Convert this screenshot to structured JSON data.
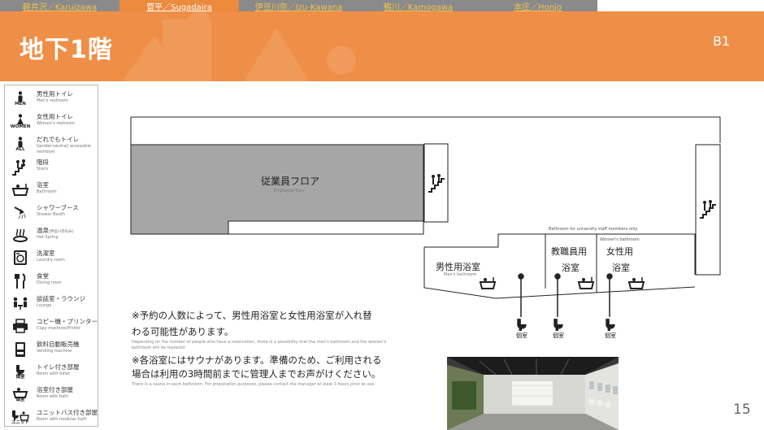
{
  "nav": {
    "tabs": [
      {
        "label": "軽井沢／Karuizawa",
        "active": false
      },
      {
        "label": "菅平／Sugadaira",
        "active": true
      },
      {
        "label": "伊豆川奈／Izu-Kawana",
        "active": false
      },
      {
        "label": "鴨川／Kamogawa",
        "active": false
      },
      {
        "label": "本庄／Honjo",
        "active": false
      }
    ]
  },
  "header": {
    "title": "地下1階",
    "floor_code": "B1",
    "color": "#ee8e47"
  },
  "legend": {
    "items": [
      {
        "ja": "男性用トイレ",
        "en": "Men's restroom",
        "icon": "men-restroom-icon",
        "caption": "MEN"
      },
      {
        "ja": "女性用トイレ",
        "en": "Women's restroom",
        "icon": "women-restroom-icon",
        "caption": "WOMEN"
      },
      {
        "ja": "だれでもトイレ",
        "en": "Gender-neutral/ accessible restroom",
        "icon": "all-restroom-icon",
        "caption": "ALL"
      },
      {
        "ja": "階段",
        "en": "Stairs",
        "icon": "stairs-icon",
        "caption": ""
      },
      {
        "ja": "浴室",
        "en": "Bathroom",
        "icon": "bathtub-icon",
        "caption": ""
      },
      {
        "ja": "シャワーブース",
        "en": "Shower Booth",
        "icon": "shower-icon",
        "caption": ""
      },
      {
        "ja": "温泉",
        "en": "Hot Spring",
        "ja_sub": "(伊豆川奈のみ)",
        "icon": "hot-spring-icon",
        "caption": ""
      },
      {
        "ja": "洗濯室",
        "en": "Laundry room",
        "icon": "laundry-icon",
        "caption": ""
      },
      {
        "ja": "食堂",
        "en": "Dining room",
        "icon": "dining-icon",
        "caption": ""
      },
      {
        "ja": "談話室・ラウンジ",
        "en": "Lounge",
        "icon": "lounge-icon",
        "caption": ""
      },
      {
        "ja": "コピー機・プリンター",
        "en": "Copy machine/Printer",
        "icon": "printer-icon",
        "caption": ""
      },
      {
        "ja": "飲料自動販売機",
        "en": "Vending machine",
        "icon": "vending-machine-icon",
        "caption": ""
      },
      {
        "ja": "トイレ付き部屋",
        "en": "Room with toilet",
        "icon": "room-toilet-icon",
        "caption": "個室"
      },
      {
        "ja": "浴室付き部屋",
        "en": "Room with bath",
        "icon": "room-bath-icon",
        "caption": "個室"
      },
      {
        "ja": "ユニットバス付き部屋",
        "en": "Room with modular bath",
        "icon": "room-unitbath-icon",
        "caption": "ユニット"
      }
    ]
  },
  "plan": {
    "employee_floor": "従業員フロア",
    "employee_floor_en": "Employee floor",
    "staff_note": "Bathroom for university staff members only",
    "mens_bath": "男性用浴室",
    "mens_bath_en": "Men's bathroom",
    "staff_bath_1": "教職員用",
    "staff_bath_2": "浴室",
    "womens_bath_en": "Women's bathroom",
    "womens_bath_1": "女性用",
    "womens_bath_2": "浴室",
    "private_label": "個室"
  },
  "notes": {
    "note1_line1": "※予約の人数によって、男性用浴室と女性用浴室が入れ替",
    "note1_line2": "わる可能性があります。",
    "note1_en_line1": "Depending on the number of people who have a reservation, there is a possibility that the men's bathroom and the women's",
    "note1_en_line2": "bathroom will be replaced.",
    "note2_line1": "※各浴室にはサウナがあります。準備のため、ご利用される",
    "note2_line2": "場合は利用の3時間前までに管理人までお声がけください。",
    "note2_en": "There is a sauna in each bathroom. For preparation purposes, please contact the manager at least 3 hours prior to use."
  },
  "page_number": "15"
}
